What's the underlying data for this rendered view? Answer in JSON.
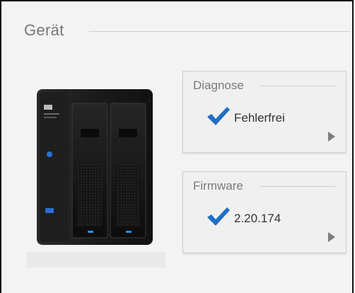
{
  "section": {
    "title": "Gerät"
  },
  "device": {
    "icon": "nas-device-image"
  },
  "cards": {
    "diagnose": {
      "title": "Diagnose",
      "status": "Fehlerfrei",
      "status_icon": "check-icon",
      "arrow_icon": "chevron-right-icon"
    },
    "firmware": {
      "title": "Firmware",
      "version": "2.20.174",
      "status_icon": "check-icon",
      "arrow_icon": "chevron-right-icon"
    }
  },
  "colors": {
    "check": "#1f6fc4",
    "panel_bg": "#f3f3f3",
    "card_bg": "#f0f0f0",
    "arrow": "#7d7d7d"
  }
}
